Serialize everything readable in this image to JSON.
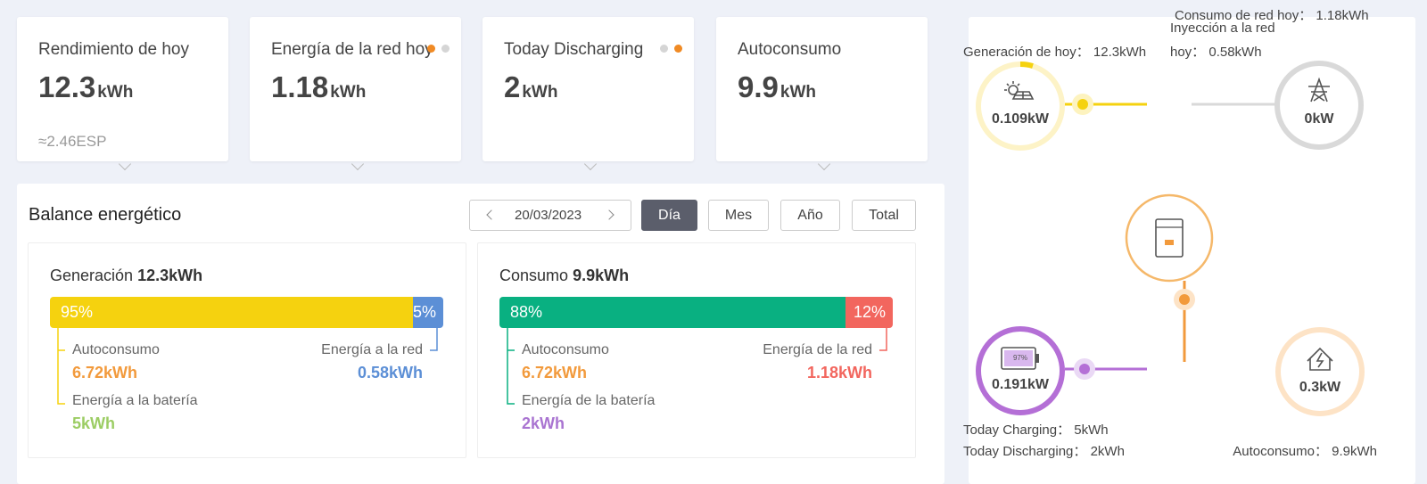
{
  "cards": [
    {
      "title": "Rendimiento de hoy",
      "value": "12.3",
      "unit": "kWh",
      "sub": "≈2.46ESP"
    },
    {
      "title": "Energía de la red hoy",
      "value": "1.18",
      "unit": "kWh"
    },
    {
      "title": "Today Discharging",
      "value": "2",
      "unit": "kWh"
    },
    {
      "title": "Autoconsumo",
      "value": "9.9",
      "unit": "kWh"
    }
  ],
  "balance": {
    "title": "Balance energético",
    "date": "20/03/2023",
    "periods": [
      "Día",
      "Mes",
      "Año",
      "Total"
    ],
    "active_period": "Día",
    "generation": {
      "label": "Generación",
      "total": "12.3kWh",
      "left_pct": "95%",
      "right_pct": "5%",
      "left_fraction": 0.95,
      "self_label": "Autoconsumo",
      "self_value": "6.72kWh",
      "grid_label": "Energía a la red",
      "grid_value": "0.58kWh",
      "battery_label": "Energía a la batería",
      "battery_value": "5kWh"
    },
    "consumption": {
      "label": "Consumo",
      "total": "9.9kWh",
      "left_pct": "88%",
      "right_pct": "12%",
      "left_fraction": 0.88,
      "self_label": "Autoconsumo",
      "self_value": "6.72kWh",
      "grid_label": "Energía de la red",
      "grid_value": "1.18kWh",
      "battery_label": "Energía de la batería",
      "battery_value": "2kWh"
    }
  },
  "flow": {
    "grid_consumption": "Consumo de red hoy： 1.18kWh",
    "injection_line1": "Inyección a la red",
    "injection_line2": "hoy： 0.58kWh",
    "generation_today": "Generación de hoy： 12.3kWh",
    "solar_power": "0.109kW",
    "grid_power": "0kW",
    "battery_power": "0.191kW",
    "battery_soc": "97%",
    "home_power": "0.3kW",
    "charging": "Today Charging： 5kWh",
    "discharging": "Today Discharging： 2kWh",
    "self_consumption": "Autoconsumo： 9.9kWh"
  },
  "colors": {
    "solar": "#f5d20f",
    "grid_out": "#5c8fd6",
    "self": "#09b081",
    "grid_in": "#f2665e",
    "orange": "#f29a3c",
    "battery": "#b46fd6",
    "battery_text": "#a974d1",
    "green_text": "#9ccd64"
  }
}
